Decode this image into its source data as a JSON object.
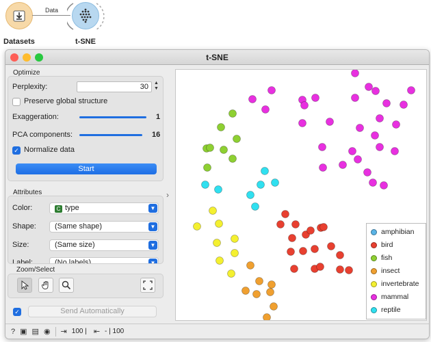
{
  "workflow": {
    "nodes": [
      {
        "label": "Datasets",
        "icon": "download-icon"
      },
      {
        "label": "t-SNE",
        "icon": "scatter-dots-icon"
      }
    ],
    "link_label": "Data"
  },
  "window": {
    "title": "t-SNE"
  },
  "optimize": {
    "title": "Optimize",
    "perplexity_label": "Perplexity:",
    "perplexity_value": "30",
    "preserve_label": "Preserve global structure",
    "preserve_checked": false,
    "exaggeration_label": "Exaggeration:",
    "exaggeration_value": "1",
    "exaggeration_fraction": 0.98,
    "pca_label": "PCA components:",
    "pca_value": "16",
    "pca_fraction": 1.0,
    "normalize_label": "Normalize data",
    "normalize_checked": true,
    "start_label": "Start"
  },
  "attributes": {
    "title": "Attributes",
    "color_label": "Color:",
    "color_badge": "C",
    "color_value": "type",
    "shape_label": "Shape:",
    "shape_value": "(Same shape)",
    "size_label": "Size:",
    "size_value": "(Same size)",
    "label_label": "Label:",
    "label_value": "(No labels)"
  },
  "zoom": {
    "title": "Zoom/Select"
  },
  "send": {
    "label": "Send Automatically",
    "checked": true
  },
  "status": {
    "input": "100 |",
    "output": "- | 100"
  },
  "legend": [
    {
      "name": "amphibian",
      "color": "#5ab4e6"
    },
    {
      "name": "bird",
      "color": "#e84030"
    },
    {
      "name": "fish",
      "color": "#8ed032"
    },
    {
      "name": "insect",
      "color": "#f0a030"
    },
    {
      "name": "invertebrate",
      "color": "#f4f030"
    },
    {
      "name": "mammal",
      "color": "#e830e0"
    },
    {
      "name": "reptile",
      "color": "#30e0f0"
    }
  ],
  "colors": {
    "accent": "#1f6ee0",
    "badge_green": "#2e7d32"
  }
}
